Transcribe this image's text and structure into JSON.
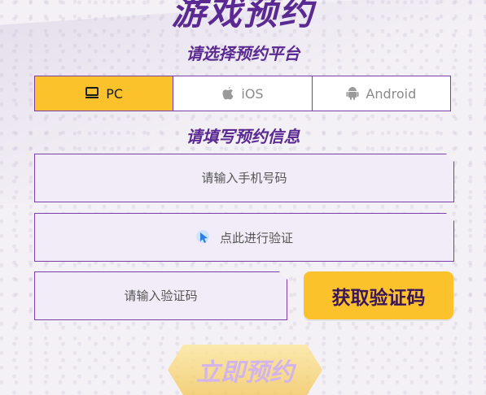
{
  "header": {
    "title": "游戏预约"
  },
  "platform_section": {
    "title": "请选择预约平台",
    "tabs": [
      {
        "label": "PC",
        "icon": "monitor-icon",
        "selected": true
      },
      {
        "label": "iOS",
        "icon": "apple-icon",
        "selected": false
      },
      {
        "label": "Android",
        "icon": "android-icon",
        "selected": false
      }
    ]
  },
  "info_section": {
    "title": "请填写预约信息",
    "phone_placeholder": "请输入手机号码",
    "verify_label": "点此进行验证",
    "verify_icon": "cursor-click-icon",
    "code_placeholder": "请输入验证码",
    "get_code_label": "获取验证码"
  },
  "submit": {
    "label": "立即预约"
  },
  "colors": {
    "accent_yellow": "#fcc22c",
    "brand_purple": "#5a2a92",
    "border_purple": "#7a3ea8",
    "field_bg": "#f1ecf8"
  }
}
